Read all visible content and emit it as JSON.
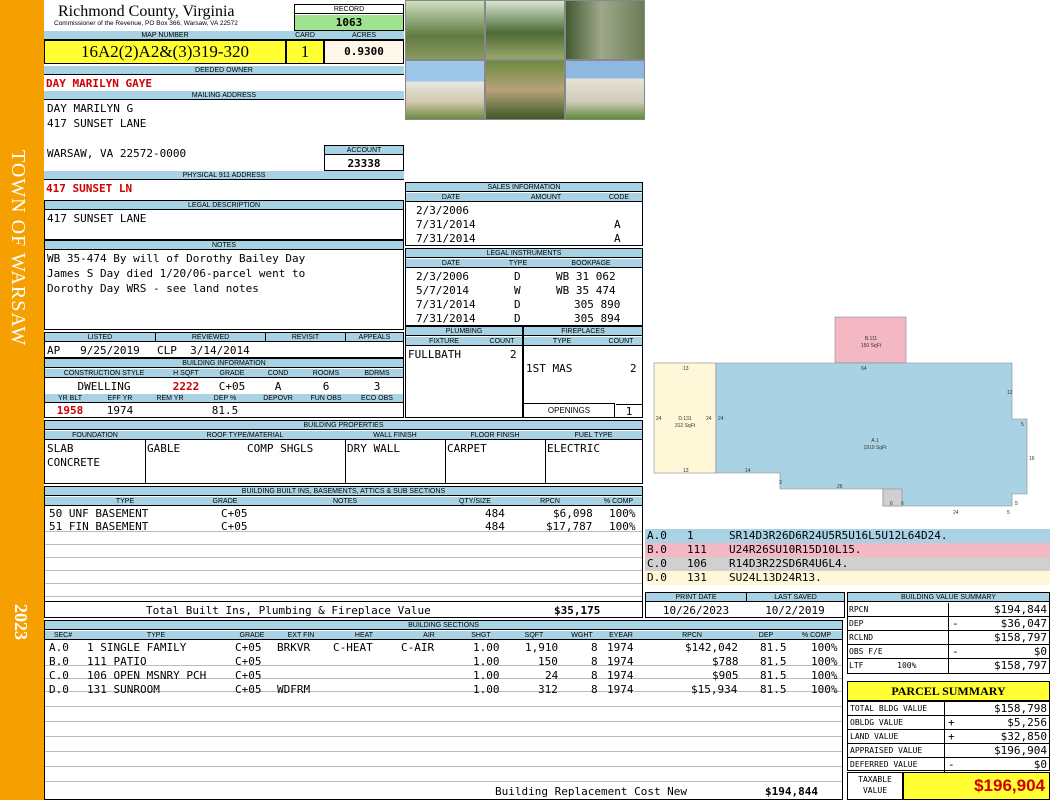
{
  "sidebar": {
    "town": "TOWN OF WARSAW",
    "year": "2023"
  },
  "header": {
    "county": "Richmond County, Virginia",
    "commissioner": "Commissioner of the Revenue, PO Box 366, Warsaw, VA 22572",
    "record_label": "RECORD",
    "record": "1063",
    "map_label": "MAP NUMBER",
    "map_number": "16A2(2)A2&(3)319-320",
    "card_label": "CARD",
    "card": "1",
    "acres_label": "ACRES",
    "acres": "0.9300"
  },
  "owner": {
    "label": "DEEDED OWNER",
    "name": "DAY MARILYN GAYE"
  },
  "mailing": {
    "label": "MAILING ADDRESS",
    "line1": "DAY MARILYN G",
    "line2": "417 SUNSET LANE",
    "line3": "WARSAW, VA 22572-0000",
    "account_label": "ACCOUNT",
    "account": "23338"
  },
  "physical": {
    "label": "PHYSICAL 911 ADDRESS",
    "value": "417 SUNSET LN"
  },
  "legal": {
    "label": "LEGAL DESCRIPTION",
    "value": "417 SUNSET LANE"
  },
  "notes": {
    "label": "NOTES",
    "line1": "WB 35-474 By will of Dorothy Bailey Day",
    "line2": "James S Day died 1/20/06-parcel went to",
    "line3": "Dorothy Day WRS - see land notes"
  },
  "review": {
    "listed_label": "LISTED",
    "reviewed_label": "REVIEWED",
    "revisit_label": "REVISIT",
    "appeals_label": "APPEALS",
    "listed": "AP   9/25/2019",
    "reviewed": "CLP  3/14/2014"
  },
  "building_info": {
    "label": "BUILDING INFORMATION",
    "h": [
      "CONSTRUCTION STYLE",
      "H SQFT",
      "GRADE",
      "COND",
      "ROOMS",
      "BDRMS"
    ],
    "v": [
      "DWELLING",
      "2222",
      "C+05",
      "A",
      "6",
      "3"
    ],
    "h2": [
      "YR BLT",
      "EFF YR",
      "REM YR",
      "DEP %",
      "DEPOVR",
      "FUN OBS",
      "ECO OBS"
    ],
    "v2": [
      "1958",
      "1974",
      "",
      "81.5",
      "",
      "",
      ""
    ]
  },
  "sales": {
    "label": "SALES INFORMATION",
    "h": [
      "DATE",
      "AMOUNT",
      "CODE"
    ],
    "rows": [
      [
        "2/3/2006",
        "",
        ""
      ],
      [
        "7/31/2014",
        "",
        "A"
      ],
      [
        "7/31/2014",
        "",
        "A"
      ]
    ]
  },
  "legal_instr": {
    "label": "LEGAL INSTRUMENTS",
    "h": [
      "DATE",
      "TYPE",
      "BOOKPAGE"
    ],
    "rows": [
      [
        "2/3/2006",
        "D",
        "WB 31 062"
      ],
      [
        "5/7/2014",
        "W",
        "WB 35 474"
      ],
      [
        "7/31/2014",
        "D",
        "305 890"
      ],
      [
        "7/31/2014",
        "D",
        "305 894"
      ]
    ]
  },
  "plumbing": {
    "label": "PLUMBING",
    "h": [
      "FIXTURE",
      "COUNT"
    ],
    "fixture": "FULLBATH",
    "count": "2"
  },
  "fireplaces": {
    "label": "FIREPLACES",
    "h": [
      "TYPE",
      "COUNT"
    ],
    "type": "1ST MAS",
    "count": "2",
    "openings_label": "OPENINGS",
    "openings": "1"
  },
  "props": {
    "label": "BUILDING PROPERTIES",
    "h": [
      "FOUNDATION",
      "ROOF TYPE/MATERIAL",
      "WALL FINISH",
      "FLOOR FINISH",
      "FUEL TYPE"
    ],
    "foundation1": "SLAB",
    "foundation2": "CONCRETE",
    "roof1": "GABLE",
    "roof2": "COMP SHGLS",
    "wall": "DRY WALL",
    "floor": "CARPET",
    "fuel": "ELECTRIC"
  },
  "builtins": {
    "label": "BUILDING BUILT INS, BASEMENTS, ATTICS & SUB SECTIONS",
    "h": [
      "TYPE",
      "GRADE",
      "NOTES",
      "QTY/SIZE",
      "RPCN",
      "% COMP"
    ],
    "rows": [
      [
        "50 UNF BASEMENT",
        "C+05",
        "",
        "484",
        "$6,098",
        "100%"
      ],
      [
        "51 FIN BASEMENT",
        "C+05",
        "",
        "484",
        "$17,787",
        "100%"
      ]
    ],
    "total_label": "Total Built Ins, Plumbing & Fireplace Value",
    "total": "$35,175"
  },
  "sketch": {
    "labels": {
      "b111": "B.111",
      "b111sq": "150 SqFt",
      "d131": "D.131",
      "d131sq": "312 SqFt",
      "a1": "A.1",
      "a1sq": "1910 SqFt"
    },
    "dims": [
      "13",
      "64",
      "12",
      "24",
      "24",
      "24",
      "5",
      "16",
      "13",
      "14",
      "3",
      "26",
      "6",
      "6",
      "5",
      "24",
      "5"
    ]
  },
  "vectors": [
    {
      "code": "A.0",
      "num": "1",
      "text": "SR14D3R26D6R24U5R5U16L5U12L64D24.",
      "color": "#a9d3e4"
    },
    {
      "code": "B.0",
      "num": "111",
      "text": "U24R26SU10R15D10L15.",
      "color": "#f4b8c4"
    },
    {
      "code": "C.0",
      "num": "106",
      "text": "R14D3R22SD6R4U6L4.",
      "color": "#d0d0d0"
    },
    {
      "code": "D.0",
      "num": "131",
      "text": "SU24L13D24R13.",
      "color": "#fff8d8"
    }
  ],
  "print": {
    "print_label": "PRINT DATE",
    "saved_label": "LAST SAVED",
    "print_date": "10/26/2023",
    "last_saved": "10/2/2019"
  },
  "value_summary": {
    "label": "BUILDING VALUE SUMMARY",
    "rows": [
      [
        "RPCN",
        "",
        "$194,844"
      ],
      [
        "DEP",
        "-",
        "$36,047"
      ],
      [
        "RCLND",
        "",
        "$158,797"
      ],
      [
        "OBS F/E",
        "-",
        "$0"
      ],
      [
        "LTF       100%",
        "",
        "$158,797"
      ]
    ]
  },
  "sections": {
    "label": "BUILDING SECTIONS",
    "h": [
      "SEC#",
      "TYPE",
      "GRADE",
      "EXT FIN",
      "HEAT",
      "AIR",
      "SHGT",
      "SQFT",
      "WGHT",
      "EYEAR",
      "RPCN",
      "DEP",
      "% COMP"
    ],
    "rows": [
      [
        "A.0",
        "1 SINGLE FAMILY",
        "C+05",
        "BRKVR",
        "C-HEAT",
        "C-AIR",
        "1.00",
        "1,910",
        "8",
        "1974",
        "$142,042",
        "81.5",
        "100%"
      ],
      [
        "B.0",
        "111 PATIO",
        "C+05",
        "",
        "",
        "",
        "1.00",
        "150",
        "8",
        "1974",
        "$788",
        "81.5",
        "100%"
      ],
      [
        "C.0",
        "106 OPEN MSNRY PCH",
        "C+05",
        "",
        "",
        "",
        "1.00",
        "24",
        "8",
        "1974",
        "$905",
        "81.5",
        "100%"
      ],
      [
        "D.0",
        "131 SUNROOM",
        "C+05",
        "WDFRM",
        "",
        "",
        "1.00",
        "312",
        "8",
        "1974",
        "$15,934",
        "81.5",
        "100%"
      ]
    ],
    "total_label": "Building Replacement Cost New",
    "total": "$194,844"
  },
  "parcel": {
    "label": "PARCEL SUMMARY",
    "rows": [
      [
        "TOTAL BLDG VALUE",
        "",
        "$158,798"
      ],
      [
        "OBLDG VALUE",
        "+",
        "$5,256"
      ],
      [
        "LAND VALUE",
        "+",
        "$32,850"
      ],
      [
        "APPRAISED VALUE",
        "",
        "$196,904"
      ],
      [
        "DEFERRED VALUE",
        "-",
        "$0"
      ]
    ],
    "taxable_label1": "TAXABLE",
    "taxable_label2": "VALUE",
    "taxable": "$196,904"
  }
}
